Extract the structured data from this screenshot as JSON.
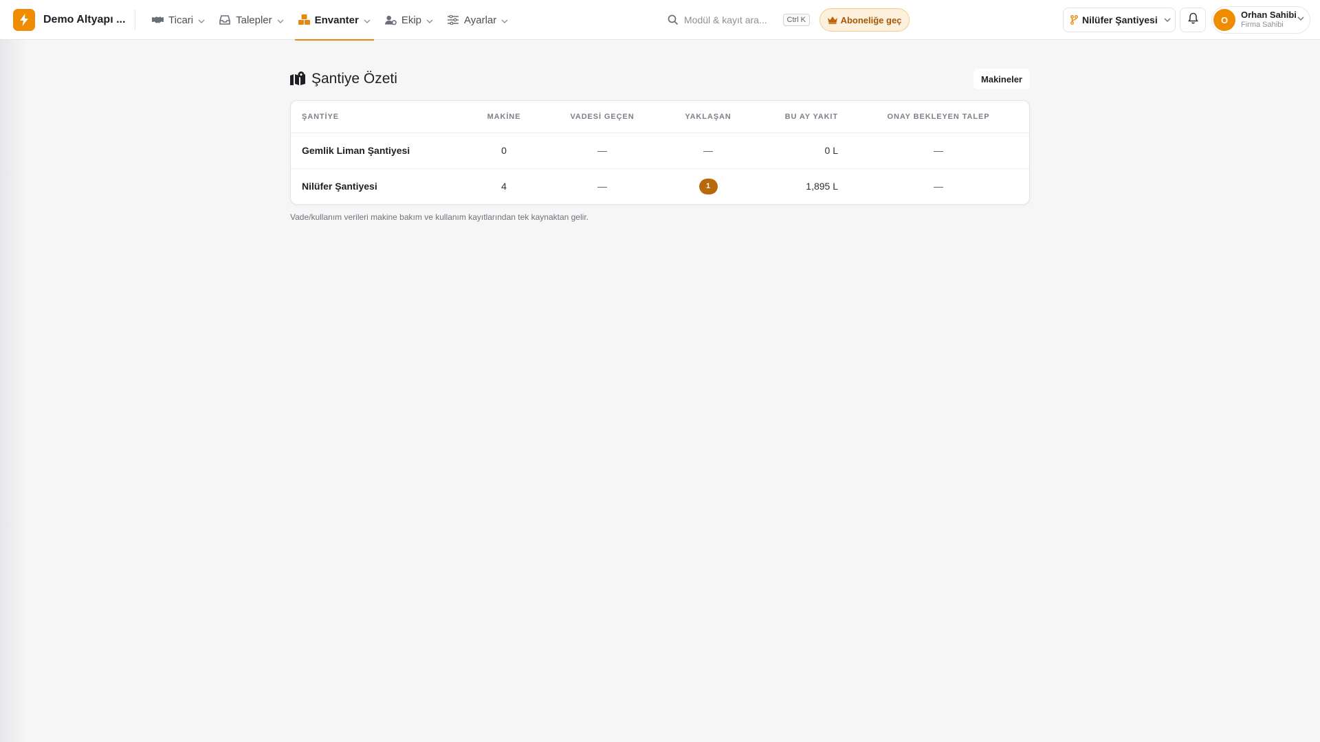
{
  "app": {
    "brand_name": "Demo Altyapı ...",
    "brand_color": "#f08c00"
  },
  "nav": {
    "items": [
      {
        "label": "Ticari",
        "icon": "handshake-icon",
        "active": false
      },
      {
        "label": "Talepler",
        "icon": "inbox-icon",
        "active": false
      },
      {
        "label": "Envanter",
        "icon": "boxes-icon",
        "active": true
      },
      {
        "label": "Ekip",
        "icon": "user-gear-icon",
        "active": false
      },
      {
        "label": "Ayarlar",
        "icon": "sliders-icon",
        "active": false
      }
    ]
  },
  "search": {
    "placeholder": "Modül & kayıt ara...",
    "shortcut": "Ctrl K"
  },
  "upgrade": {
    "label": "Aboneliğe geç",
    "icon": "crown-icon"
  },
  "site_selector": {
    "value": "Nilüfer Şantiyesi",
    "icon": "code-branch-icon"
  },
  "notifications": {
    "icon": "bell-icon"
  },
  "user": {
    "initial": "O",
    "name": "Orhan Sahibi",
    "role": "Firma Sahibi"
  },
  "page": {
    "title": "Şantiye Özeti",
    "title_icon": "map-location-icon",
    "machines_button": "Makineler"
  },
  "table": {
    "headers": {
      "site": "ŞANTİYE",
      "machines": "MAKİNE",
      "overdue": "VADESİ GEÇEN",
      "upcoming": "YAKLAŞAN",
      "fuel": "BU AY YAKIT",
      "pending": "ONAY BEKLEYEN TALEP"
    },
    "rows": [
      {
        "site": "Gemlik Liman Şantiyesi",
        "machines": "0",
        "overdue": "—",
        "upcoming": "—",
        "fuel": "0 L",
        "pending": "—"
      },
      {
        "site": "Nilüfer Şantiyesi",
        "machines": "4",
        "overdue": "—",
        "upcoming": "1",
        "fuel": "1,895 L",
        "pending": "—"
      }
    ],
    "badge_color": "#b8690a"
  },
  "footnote": "Vade/kullanım verileri makine bakım ve kullanım kayıtlarından tek kaynaktan gelir."
}
